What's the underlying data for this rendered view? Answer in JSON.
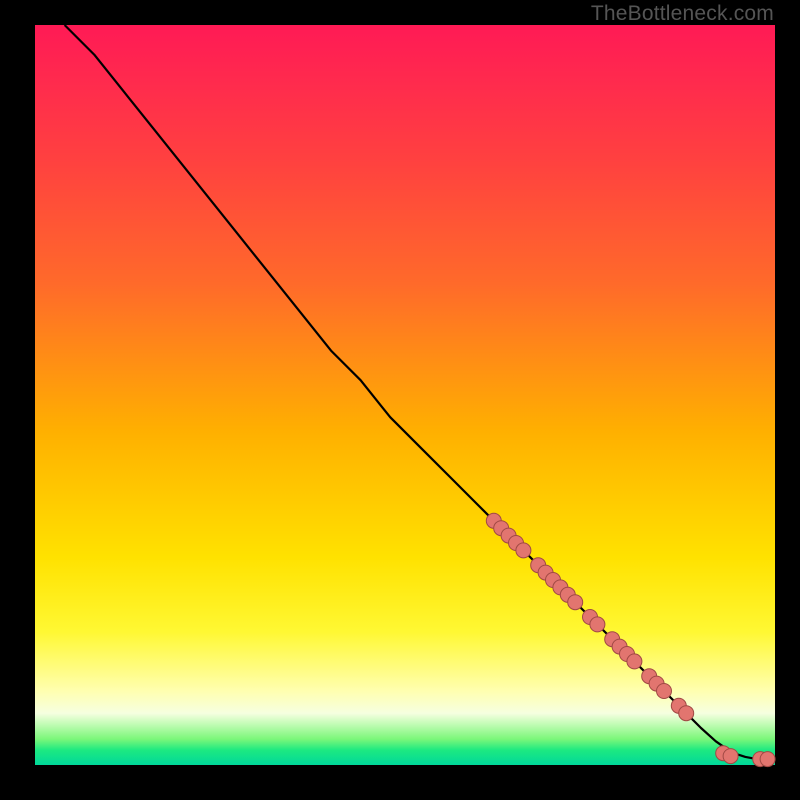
{
  "watermark": "TheBottleneck.com",
  "colors": {
    "line": "#000000",
    "marker_fill": "#e2756f",
    "marker_stroke": "#a04944"
  },
  "chart_data": {
    "type": "line",
    "title": "",
    "xlabel": "",
    "ylabel": "",
    "xlim": [
      0,
      100
    ],
    "ylim": [
      0,
      100
    ],
    "grid": false,
    "legend": false,
    "series": [
      {
        "name": "curve",
        "x": [
          4,
          8,
          12,
          16,
          20,
          24,
          28,
          32,
          36,
          40,
          44,
          48,
          52,
          56,
          60,
          62,
          64,
          66,
          68,
          70,
          72,
          74,
          76,
          78,
          80,
          82,
          84,
          86,
          88,
          90,
          92,
          94,
          95,
          96,
          97,
          98,
          99
        ],
        "y": [
          100,
          96,
          91,
          86,
          81,
          76,
          71,
          66,
          61,
          56,
          52,
          47,
          43,
          39,
          35,
          33,
          31,
          29,
          27,
          25,
          23,
          21,
          19,
          17,
          15,
          13,
          11,
          9,
          7,
          5,
          3.2,
          1.8,
          1.4,
          1.1,
          0.9,
          0.8,
          0.8
        ]
      }
    ],
    "markers": [
      {
        "x": 62,
        "y": 33
      },
      {
        "x": 63,
        "y": 32
      },
      {
        "x": 64,
        "y": 31
      },
      {
        "x": 65,
        "y": 30
      },
      {
        "x": 66,
        "y": 29
      },
      {
        "x": 68,
        "y": 27
      },
      {
        "x": 69,
        "y": 26
      },
      {
        "x": 70,
        "y": 25
      },
      {
        "x": 71,
        "y": 24
      },
      {
        "x": 72,
        "y": 23
      },
      {
        "x": 73,
        "y": 22
      },
      {
        "x": 75,
        "y": 20
      },
      {
        "x": 76,
        "y": 19
      },
      {
        "x": 78,
        "y": 17
      },
      {
        "x": 79,
        "y": 16
      },
      {
        "x": 80,
        "y": 15
      },
      {
        "x": 81,
        "y": 14
      },
      {
        "x": 83,
        "y": 12
      },
      {
        "x": 84,
        "y": 11
      },
      {
        "x": 85,
        "y": 10
      },
      {
        "x": 87,
        "y": 8
      },
      {
        "x": 88,
        "y": 7
      },
      {
        "x": 93,
        "y": 1.6
      },
      {
        "x": 94,
        "y": 1.2
      },
      {
        "x": 98,
        "y": 0.8
      },
      {
        "x": 99,
        "y": 0.8
      }
    ]
  }
}
